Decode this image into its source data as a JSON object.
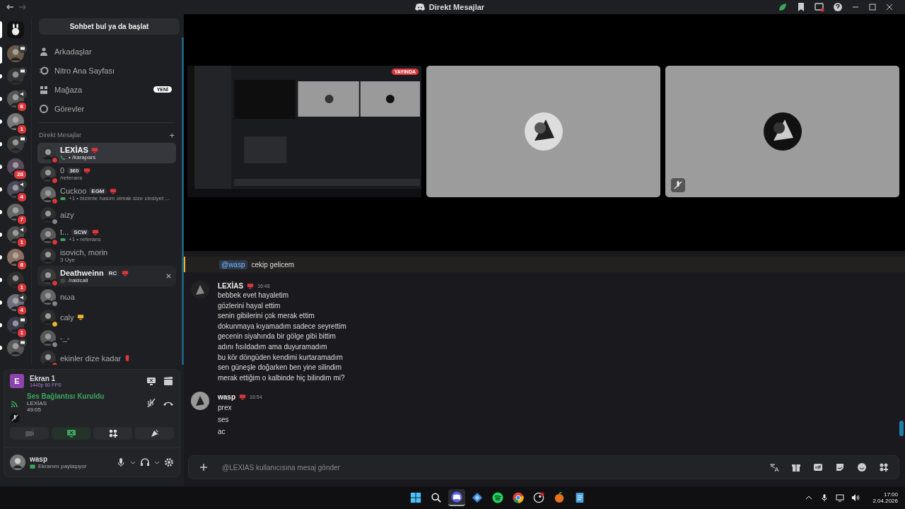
{
  "window": {
    "title": "Direkt Mesajlar"
  },
  "servers": [
    {
      "selected": true
    },
    {
      "selected": true,
      "screen": true
    },
    {
      "selected": false,
      "unread": true,
      "screen": true
    },
    {
      "selected": false,
      "unread": true,
      "voice": true,
      "badge": "6"
    },
    {
      "selected": false,
      "unread": true,
      "badge": "1"
    },
    {
      "selected": false,
      "unread": true,
      "screen": true
    },
    {
      "selected": false,
      "unread": true,
      "badge": "28"
    },
    {
      "selected": false,
      "unread": true,
      "voice": true,
      "badge": "4"
    },
    {
      "selected": false,
      "unread": true,
      "badge": "7"
    },
    {
      "selected": false,
      "unread": true,
      "voice": true,
      "badge": "1"
    },
    {
      "selected": false,
      "unread": true,
      "badge": "8"
    },
    {
      "selected": false,
      "unread": true,
      "badge": "1"
    },
    {
      "selected": false,
      "unread": true,
      "voice": true,
      "badge": "4"
    },
    {
      "selected": false,
      "unread": true,
      "screen": true,
      "badge": "1"
    },
    {
      "selected": false,
      "unread": true,
      "screen": true
    }
  ],
  "search": {
    "label": "Sohbet bul ya da başlat"
  },
  "nav": [
    {
      "kind": "friends",
      "label": "Arkadaşlar"
    },
    {
      "kind": "nitro",
      "label": "Nitro Ana Sayfası"
    },
    {
      "kind": "shop",
      "label": "Mağaza",
      "badge": "YENİ"
    },
    {
      "kind": "quests",
      "label": "Görevler"
    }
  ],
  "dm_header": {
    "label": "Direkt Mesajlar",
    "add": "+"
  },
  "dms": [
    {
      "name": "LEXİAS",
      "color": "#da373c",
      "device": {
        "kind": "desktop"
      },
      "activity": {
        "kind": "call",
        "text": "• /karapars"
      },
      "selected": true,
      "hovered": false
    },
    {
      "name": "0",
      "tag": "360",
      "color": "#da373c",
      "device": {
        "kind": "desktop"
      },
      "activity": {
        "kind": "text",
        "text": "/referans"
      },
      "selected": false,
      "hovered": false
    },
    {
      "name": "Cuckoo",
      "tag": "EGM",
      "color": "#da373c",
      "device": {
        "kind": "desktop"
      },
      "activity": {
        "kind": "game",
        "text": "+1 • bizimle hasım olmak size cinsiyet ..."
      },
      "selected": false,
      "hovered": false
    },
    {
      "name": "aizy",
      "color": "#80848e",
      "selected": false,
      "hovered": false
    },
    {
      "name": "t...",
      "tag": "SCW",
      "color": "#da373c",
      "device": {
        "kind": "desktop"
      },
      "activity": {
        "kind": "game",
        "text": "+1 • referans"
      },
      "selected": false,
      "hovered": false
    },
    {
      "name": "isovich, morin",
      "activity": {
        "kind": "text",
        "text": "3 Üye"
      },
      "selected": false,
      "hovered": false
    },
    {
      "name": "Deathweinn",
      "tag": "RC",
      "color": "#da373c",
      "device": {
        "kind": "desktop"
      },
      "activity": {
        "kind": "app",
        "text": "/raidcall"
      },
      "selected": false,
      "hovered": true
    },
    {
      "name": "nωa",
      "color": "#80848e",
      "selected": false,
      "hovered": false
    },
    {
      "name": "caly",
      "color": "#f0b232",
      "device": {
        "kind": "desktop"
      },
      "selected": false,
      "hovered": false
    },
    {
      "name": "-_-",
      "color": "#80848e",
      "selected": false,
      "hovered": false
    },
    {
      "name": "ekinler dize kadar",
      "color": "#da373c",
      "device": {
        "kind": "mobile"
      },
      "selected": false,
      "hovered": false
    }
  ],
  "stream": {
    "letter": "E",
    "title": "Ekran 1",
    "quality": "1440p 60 FPS"
  },
  "voice": {
    "status": "Ses Bağlantısı Kuruldu",
    "channel": "LEXİAS",
    "duration": "49:05",
    "screen_share": true
  },
  "user": {
    "name": "wasp",
    "status": "Ekranını paylaşıyor"
  },
  "tiles": [
    {
      "kind": "stream",
      "badge": "YAYINDA",
      "muted": false
    },
    {
      "kind": "avatar",
      "muted": false
    },
    {
      "kind": "avatar",
      "muted": true
    }
  ],
  "reply": {
    "mention": "@wasp",
    "text": "cekip gelicem"
  },
  "messages": [
    {
      "author": "LEXİAS",
      "time": "16:48",
      "lines": [
        "bebbek evet hayaletim",
        "gözlerini hayal ettim",
        "senin gibilerini çok merak ettim",
        "dokunmaya kıyamadım sadece seyrettim",
        "gecenin siyahında bir gölge gibi bittim",
        "adını fısıldadım ama duyuramadım",
        "bu kör döngüden kendimi kurtaramadım",
        "sen güneşle doğarken ben yine silindim",
        "merak ettiğim o kalbinde hiç bilindim mi?"
      ]
    },
    {
      "author": "wasp",
      "time": "16:54",
      "lines": [
        "prex",
        "ses",
        "ac"
      ]
    }
  ],
  "composer": {
    "placeholder": "@LEXİAS kullanıcısına mesaj gönder"
  },
  "taskbar": {
    "apps": [
      {
        "kind": "start",
        "active": false
      },
      {
        "kind": "search",
        "active": false
      },
      {
        "kind": "discord",
        "active": true
      },
      {
        "kind": "cube",
        "active": false
      },
      {
        "kind": "spotify",
        "active": false
      },
      {
        "kind": "chrome",
        "active": false
      },
      {
        "kind": "steam",
        "active": false
      },
      {
        "kind": "fruit",
        "active": false
      },
      {
        "kind": "notepad",
        "active": false
      }
    ],
    "time": "17:00",
    "date": "2.04.2026"
  }
}
